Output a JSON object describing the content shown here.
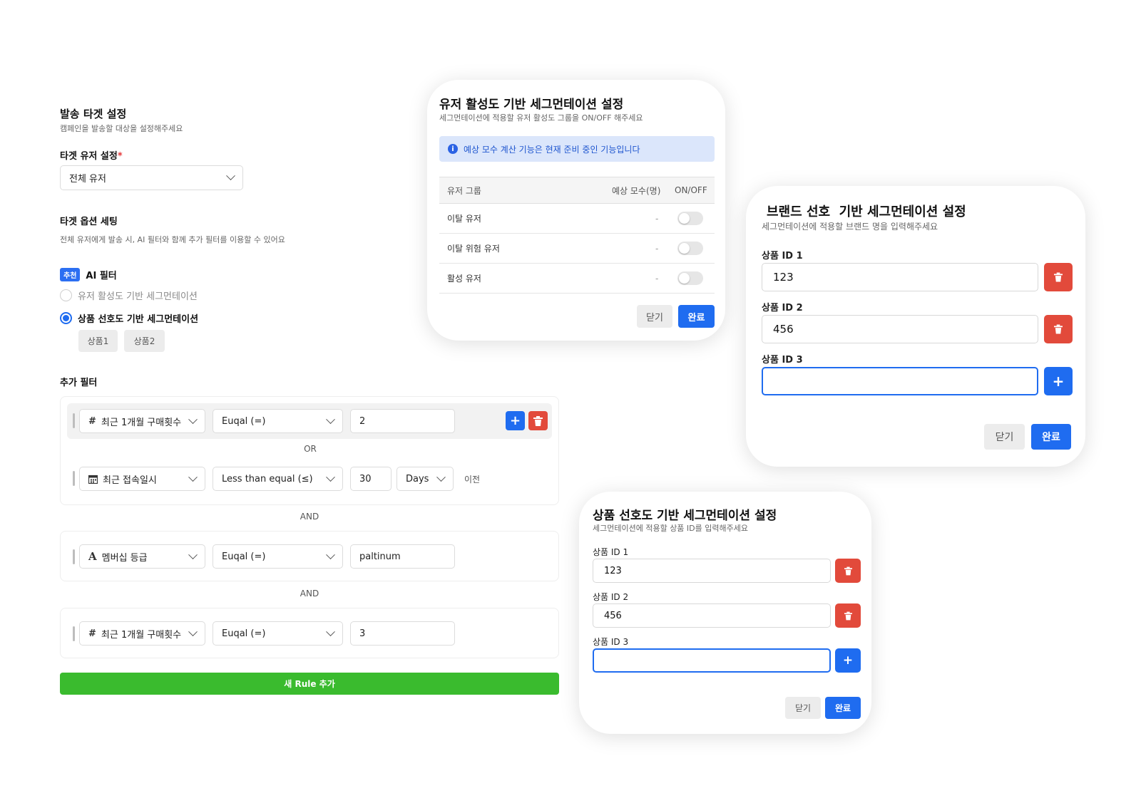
{
  "main": {
    "title": "발송 타겟 설정",
    "desc": "캠페인을 발송할 대상을 설정해주세요",
    "target_user": {
      "label": "타겟 유저 설정",
      "required_mark": "*",
      "value": "전체 유저"
    },
    "options": {
      "title": "타겟 옵션 세팅",
      "desc": "전체 유저에게 발송 시, AI 필터와 함께 추가 필터를 이용할 수 있어요",
      "badge": "추천",
      "ai_filter": "AI 필터",
      "radio_activity": "유저 활성도 기반 세그먼테이션",
      "radio_product": "상품 선호도 기반 세그먼테이션",
      "chips": [
        "상품1",
        "상품2"
      ]
    },
    "extra_filter": {
      "title": "추가 필터",
      "rule1": {
        "row1": {
          "field": "최근 1개월 구매횟수",
          "field_icon": "#",
          "operator": "Euqal (=)",
          "value": "2"
        },
        "connector": "OR",
        "row2": {
          "field": "최근 접속일시",
          "field_icon": "calendar-icon",
          "operator": "Less than equal (≤)",
          "value": "30",
          "unit": "Days",
          "suffix": "이전"
        }
      },
      "connector1": "AND",
      "rule2": {
        "field": "멤버십 등급",
        "field_icon": "A",
        "operator": "Euqal (=)",
        "value": "paltinum"
      },
      "connector2": "AND",
      "rule3": {
        "field": "최근 1개월 구매횟수",
        "field_icon": "#",
        "operator": "Euqal (=)",
        "value": "3"
      }
    },
    "add_rule_button": "새 Rule 추가"
  },
  "activity_modal": {
    "title": "유저 활성도 기반 세그먼테이션 설정",
    "desc": "세그먼테이션에 적용할 유저 활성도 그룹을 ON/OFF 해주세요",
    "notice": "예상 모수 계산 기능은 현재 준비 중인 기능입니다",
    "headers": {
      "group": "유저 그룹",
      "count": "예상 모수(명)",
      "onoff": "ON/OFF"
    },
    "rows": [
      {
        "group": "이탈 유저",
        "count": "-"
      },
      {
        "group": "이탈 위험 유저",
        "count": "-"
      },
      {
        "group": "활성 유저",
        "count": "-"
      }
    ],
    "close": "닫기",
    "done": "완료"
  },
  "brand_modal": {
    "title": "브랜드 선호  기반 세그먼테이션 설정",
    "desc": "세그먼테이션에 적용할 브랜드 명을 입력해주세요",
    "fields": [
      {
        "label": "상품 ID 1",
        "value": "123"
      },
      {
        "label": "상품 ID 2",
        "value": "456"
      },
      {
        "label": "상품 ID 3",
        "value": ""
      }
    ],
    "close": "닫기",
    "done": "완료"
  },
  "product_modal": {
    "title": "상품 선호도 기반 세그먼테이션 설정",
    "desc": "세그먼테이션에 적용할 상품 ID를 입력해주세요",
    "fields": [
      {
        "label": "상품 ID 1",
        "value": "123"
      },
      {
        "label": "상품 ID 2",
        "value": "456"
      },
      {
        "label": "상품 ID 3",
        "value": ""
      }
    ],
    "close": "닫기",
    "done": "완료"
  },
  "colors": {
    "primary": "#1f6cf0",
    "danger": "#e24a3b",
    "success": "#3abb2e",
    "notice_bg": "#dbe6fb"
  }
}
